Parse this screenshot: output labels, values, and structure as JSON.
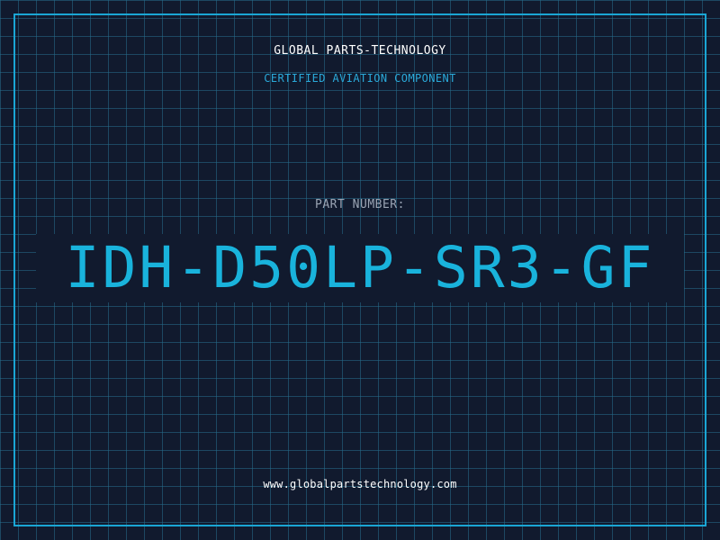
{
  "header": {
    "company": "GLOBAL PARTS-TECHNOLOGY",
    "subtitle": "CERTIFIED AVIATION COMPONENT"
  },
  "part": {
    "label": "PART NUMBER:",
    "number": "IDH-D50LP-SR3-GF"
  },
  "footer": {
    "website": "www.globalpartstechnology.com"
  },
  "colors": {
    "background": "#111a2e",
    "grid": "#266e8c",
    "accent": "#19b3dc",
    "frame": "#1aa6d4",
    "text": "#ffffff",
    "muted": "#9aa4b4"
  }
}
